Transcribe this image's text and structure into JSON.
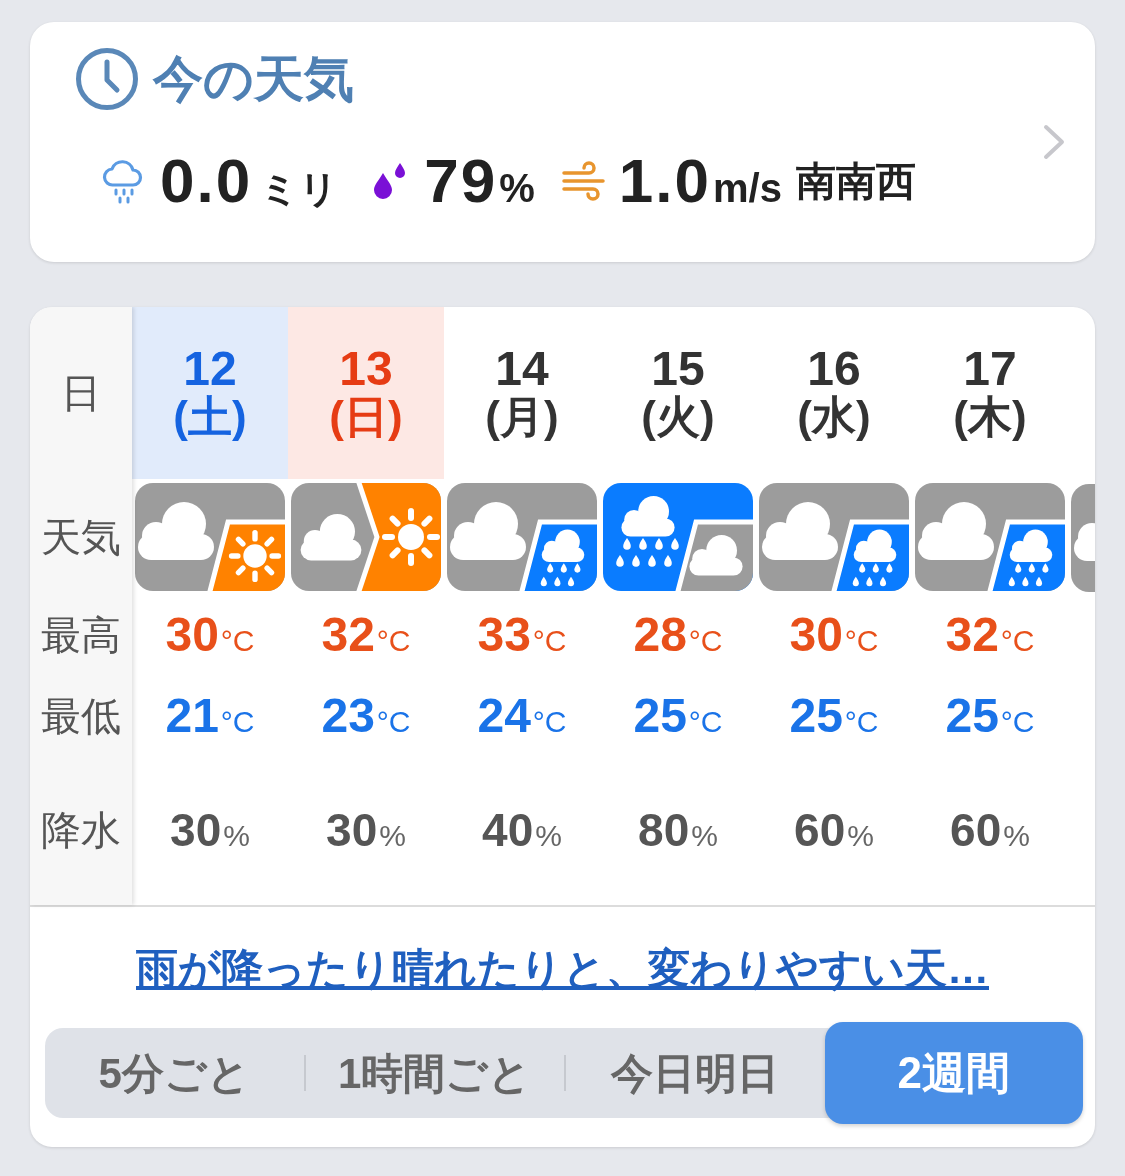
{
  "current": {
    "title": "今の天気",
    "precipitation": {
      "value": "0.0",
      "unit": "ミリ"
    },
    "humidity": {
      "value": "79",
      "unit": "%"
    },
    "wind": {
      "value": "1.0",
      "unit": "m/s",
      "direction": "南南西"
    }
  },
  "forecast": {
    "row_labels": [
      "日",
      "天気",
      "最高",
      "最低",
      "降水"
    ],
    "days": [
      {
        "date": "12",
        "weekday": "(土)",
        "kind": "saturday",
        "weather": {
          "kind": "cloud_sun_slant"
        },
        "high": {
          "value": "30",
          "unit": "°C"
        },
        "low": {
          "value": "21",
          "unit": "°C"
        },
        "precip": {
          "value": "30",
          "unit": "%"
        }
      },
      {
        "date": "13",
        "weekday": "(日)",
        "kind": "sunday",
        "weather": {
          "kind": "cloud_sun_chevron"
        },
        "high": {
          "value": "32",
          "unit": "°C"
        },
        "low": {
          "value": "23",
          "unit": "°C"
        },
        "precip": {
          "value": "30",
          "unit": "%"
        }
      },
      {
        "date": "14",
        "weekday": "(月)",
        "kind": "weekday",
        "weather": {
          "kind": "cloud_rain_slant"
        },
        "high": {
          "value": "33",
          "unit": "°C"
        },
        "low": {
          "value": "24",
          "unit": "°C"
        },
        "precip": {
          "value": "40",
          "unit": "%"
        }
      },
      {
        "date": "15",
        "weekday": "(火)",
        "kind": "weekday",
        "weather": {
          "kind": "rain_cloud_slant"
        },
        "high": {
          "value": "28",
          "unit": "°C"
        },
        "low": {
          "value": "25",
          "unit": "°C"
        },
        "precip": {
          "value": "80",
          "unit": "%"
        }
      },
      {
        "date": "16",
        "weekday": "(水)",
        "kind": "weekday",
        "weather": {
          "kind": "cloud_rain_slant"
        },
        "high": {
          "value": "30",
          "unit": "°C"
        },
        "low": {
          "value": "25",
          "unit": "°C"
        },
        "precip": {
          "value": "60",
          "unit": "%"
        }
      },
      {
        "date": "17",
        "weekday": "(木)",
        "kind": "weekday",
        "weather": {
          "kind": "cloud_rain_slant"
        },
        "high": {
          "value": "32",
          "unit": "°C"
        },
        "low": {
          "value": "25",
          "unit": "°C"
        },
        "precip": {
          "value": "60",
          "unit": "%"
        }
      }
    ],
    "next_column": {
      "weather": {
        "kind": "cloud"
      }
    },
    "summary_link": "雨が降ったり晴れたりと、変わりやすい天…",
    "tabs": [
      {
        "label": "5分ごと",
        "selected": false
      },
      {
        "label": "1時間ごと",
        "selected": false
      },
      {
        "label": "今日明日",
        "selected": false
      },
      {
        "label": "2週間",
        "selected": true
      }
    ]
  }
}
